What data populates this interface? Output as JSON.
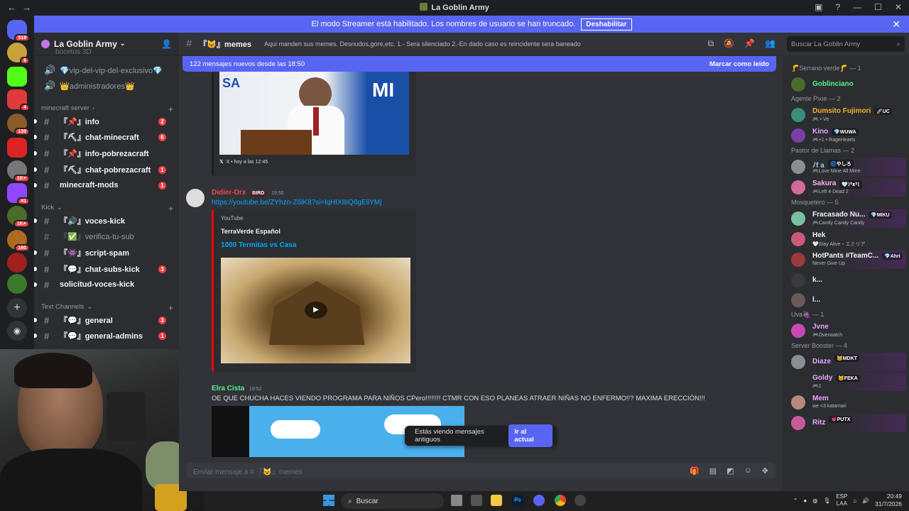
{
  "window": {
    "title": "La Goblin Army",
    "back": "←",
    "forward": "→",
    "controls": [
      "▣",
      "?",
      "—",
      "☐",
      "✕"
    ]
  },
  "banner": {
    "text": "El modo Streamer está habilitado. Los nombres de usuario se han truncado.",
    "button": "Deshabilitar",
    "close": "✕"
  },
  "guild_badges": [
    "519",
    "6",
    "",
    "4",
    "139",
    "",
    "1K+",
    "41",
    "1K+",
    "160",
    "",
    ""
  ],
  "sidebar": {
    "server_name": "La Goblin Army",
    "partial_top": "bocetos 3D",
    "channels": [
      {
        "label": "💎vip-del-vip-del-exclusivo💎",
        "icon": "🔊",
        "unread": false,
        "count": ""
      },
      {
        "label": "👑administradores👑",
        "icon": "🔊",
        "unread": false,
        "count": ""
      },
      {
        "category": "minecraft server"
      },
      {
        "label": "『📌』info",
        "icon": "#",
        "unread": true,
        "count": "2"
      },
      {
        "label": "『⛏』chat-minecraft",
        "icon": "#",
        "unread": true,
        "count": "6"
      },
      {
        "label": "『📌』info-pobrezacraft",
        "icon": "#",
        "unread": true,
        "count": ""
      },
      {
        "label": "『⛏』chat-pobrezacraft",
        "icon": "#",
        "unread": true,
        "count": "1"
      },
      {
        "label": "minecraft-mods",
        "icon": "#",
        "unread": true,
        "count": "1"
      },
      {
        "category": "Kick"
      },
      {
        "label": "『🔊』voces-kick",
        "icon": "#",
        "unread": true,
        "count": ""
      },
      {
        "label": "『✅』verifica-tu-sub",
        "icon": "#",
        "unread": false,
        "count": ""
      },
      {
        "label": "『👾』script-spam",
        "icon": "#",
        "unread": true,
        "count": ""
      },
      {
        "label": "『💬』chat-subs-kick",
        "icon": "#",
        "unread": true,
        "count": "3"
      },
      {
        "label": "solicitud-voces-kick",
        "icon": "#",
        "unread": true,
        "count": ""
      },
      {
        "category": "Text Channels"
      },
      {
        "label": "『💬』general",
        "icon": "#",
        "unread": true,
        "count": "3"
      },
      {
        "label": "『💬』general-admins",
        "icon": "#",
        "unread": true,
        "count": "1"
      }
    ]
  },
  "channel_header": {
    "name": "『😺』memes",
    "topic": "Aqui manden sus memes. Desnudos,gore,etc. 1.- Sera silenciado 2.-En dado caso es reincidente sera baneado",
    "search_placeholder": "Buscar La Goblin Army"
  },
  "new_messages_bar": {
    "text": "122 mensajes nuevos desde las 18:50",
    "action": "Marcar como leído"
  },
  "messages": {
    "embed1_footer": "X • hoy a las 12:45",
    "m2": {
      "author": "Didier-Drx",
      "tag": "BIRD",
      "time": "19:50",
      "link": "https://youtube.be/ZYhzn-Z6lK8?si=lqHIX8IQ6gEllYMj",
      "embed_provider": "YouTube",
      "embed_channel": "TerraVerde Español",
      "embed_title": "1000 Termitas vs Casa"
    },
    "m3": {
      "author": "Elra Cista",
      "time": "19:52",
      "text": "OE QUE CHUCHA HACES VIENDO PROGRAMA PARA NIÑOS CPero!!!!!!!!  CTMR  CON ESO PLANEAS ATRAER NIÑAS NO ENFERMO!!? MAXIMA ERECCIÓN!!!"
    }
  },
  "old_messages_notice": {
    "text": "Estás viendo mensajes antiguos",
    "button": "Ir al actual"
  },
  "composer": {
    "placeholder": "Enviar mensaje a # 『😺』memes"
  },
  "members": [
    {
      "role": "🦵Serrano verde🦵 — 1"
    },
    {
      "name": "Goblinciano",
      "color": "#57f287",
      "av": "#4a6b2a",
      "status": "",
      "tag": ""
    },
    {
      "role": "Agente Pixie — 2"
    },
    {
      "name": "Dumsito Fujimori",
      "color": "#f0b232",
      "av": "#3a8f7a",
      "status": "🎮 • Ve",
      "tag": "🚀UC"
    },
    {
      "name": "Kino",
      "color": "#e9a4ff",
      "av": "#7a3fa5",
      "status": "🎮+1 • RageHearts",
      "tag": "💎WUWA"
    },
    {
      "role": "Pastor de Llamas — 2"
    },
    {
      "name": "ﾉf a",
      "color": "#a4c8ff",
      "av": "#8a8f95",
      "status": "🎮Love Mine All Mine",
      "tag": "🌀やしろ"
    },
    {
      "name": "Sakura",
      "color": "#ffb3e6",
      "av": "#d46a9a",
      "status": "🎮Left 4 Dead 2",
      "tag": "🤍ﾐ⁰ᴥ⁰ﾐ"
    },
    {
      "role": "Mosquetero — 5"
    },
    {
      "name": "Fracasado Nu...",
      "color": "#f2f3f5",
      "av": "#7abfa0",
      "status": "🎮Candy Candy Candy",
      "tag": "💎MIKU"
    },
    {
      "name": "Hek",
      "color": "#f2f3f5",
      "av": "#c85a7a",
      "status": "🤍Stay Alive・エミリア",
      "tag": ""
    },
    {
      "name": "HotPants #TeamC...",
      "color": "#f2f3f5",
      "av": "#9a3a3a",
      "status": "Never Give Up",
      "tag": "💎Ahri"
    },
    {
      "name": "k...",
      "color": "#f2f3f5",
      "av": "#3a3a3a",
      "status": "",
      "tag": ""
    },
    {
      "name": "l...",
      "color": "#f2f3f5",
      "av": "#6a5a5a",
      "status": "",
      "tag": ""
    },
    {
      "role": "Uva🍇 — 1"
    },
    {
      "name": "Jvne",
      "color": "#e9a4ff",
      "av": "#c84ab0",
      "status": "🎮Overwatch",
      "tag": ""
    },
    {
      "role": "Server Booster — 4"
    },
    {
      "name": "Diaze",
      "color": "#e9a4ff",
      "av": "#8a8f95",
      "status": "",
      "tag": "🐱MDKT"
    },
    {
      "name": "Goldy",
      "color": "#e9a4ff",
      "av": "#2b2d31",
      "status": "🎮1",
      "tag": "🐱FEKA"
    },
    {
      "name": "Mem",
      "color": "#e9a4ff",
      "av": "#b58a7a",
      "status": "we <3 katamari",
      "tag": ""
    },
    {
      "name": "Ritz",
      "color": "#e9a4ff",
      "av": "#c85a9a",
      "status": "",
      "tag": "💗PUTX"
    }
  ],
  "taskbar": {
    "search": "Buscar",
    "lang_top": "ESP",
    "lang_bottom": "LAA",
    "time": "20:49",
    "date": "31/7/2026"
  }
}
